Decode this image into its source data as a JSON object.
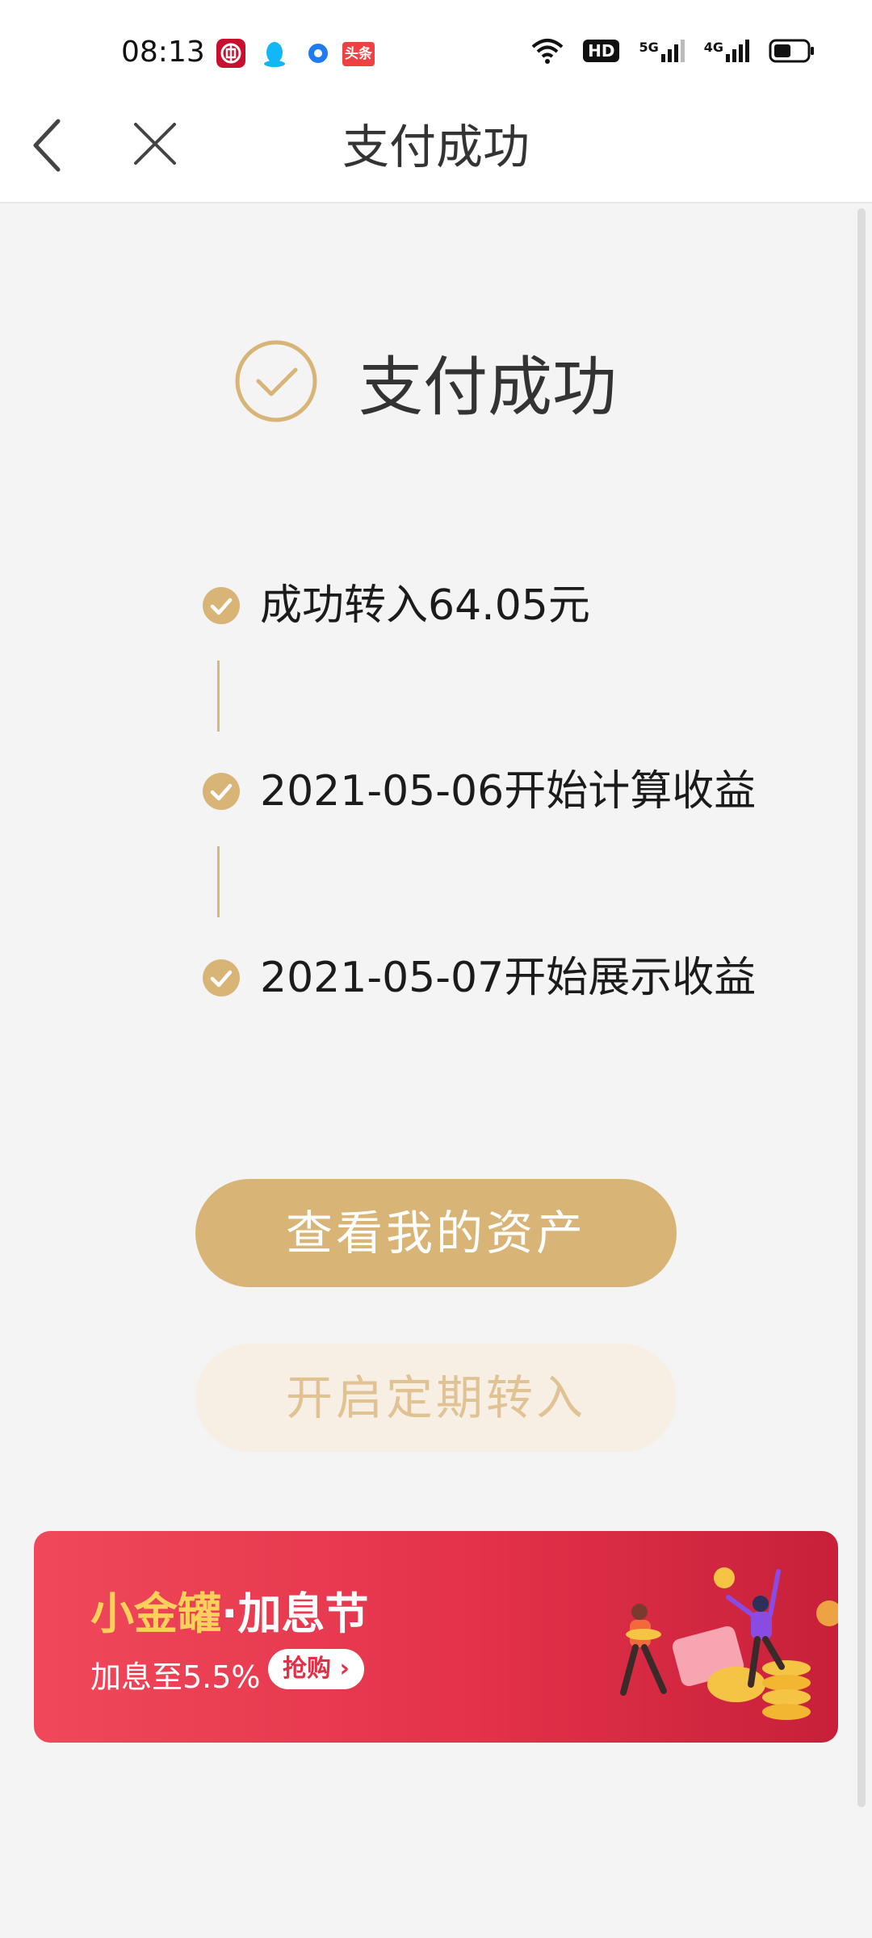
{
  "status_bar": {
    "time": "08:13",
    "app_icons": [
      "bank-app-icon",
      "qq-icon",
      "browser-icon",
      "toutiao-icon"
    ],
    "toutiao_label": "头条",
    "indicators": [
      "wifi-icon",
      "hd-icon",
      "signal-5g-icon",
      "signal-4g-icon",
      "battery-icon"
    ],
    "hd_label": "HD",
    "net_5g": "5G",
    "net_4g": "4G"
  },
  "nav": {
    "title": "支付成功",
    "back_icon": "chevron-left-icon",
    "close_icon": "close-icon"
  },
  "result": {
    "heading": "支付成功",
    "icon": "check-circle-icon"
  },
  "steps": [
    {
      "text": "成功转入64.05元"
    },
    {
      "text": "2021-05-06开始计算收益"
    },
    {
      "text": "2021-05-07开始展示收益"
    }
  ],
  "actions": {
    "primary_label": "查看我的资产",
    "secondary_label": "开启定期转入"
  },
  "banner": {
    "title_main": "小金罐",
    "title_dot": "·",
    "title_rest": "加息节",
    "subtitle": "加息至5.5%",
    "cta_label": "抢购",
    "cta_icon": "chevron-right-icon"
  },
  "colors": {
    "accent_gold": "#d8b477",
    "banner_red": "#e3324a",
    "banner_gold_text": "#ffd15a"
  }
}
